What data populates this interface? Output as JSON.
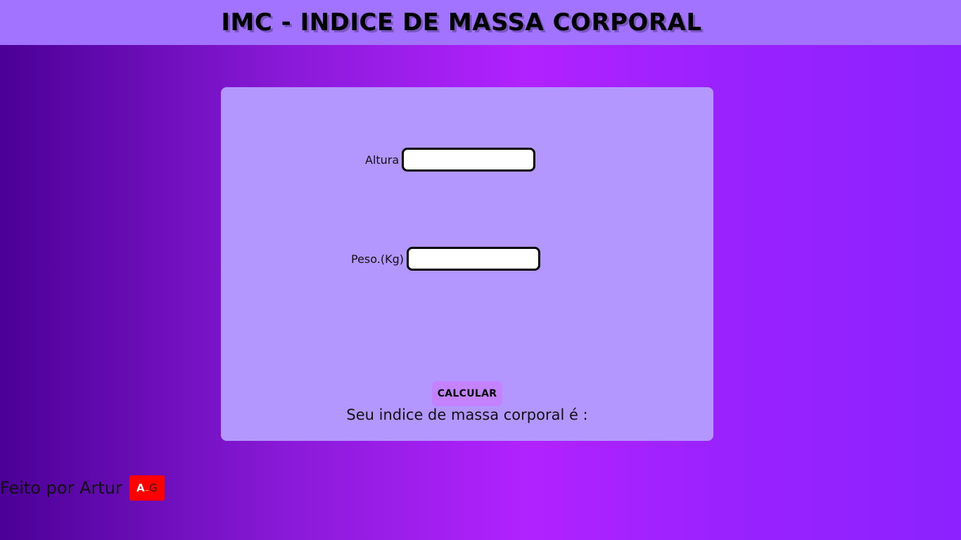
{
  "header": {
    "title": "IMC - INDICE DE MASSA CORPORAL"
  },
  "form": {
    "height_label": "Altura",
    "height_value": "",
    "weight_label": "Peso.(Kg)",
    "weight_value": "",
    "calculate_label": "CALCULAR",
    "result_text": "Seu indice de massa corporal é :"
  },
  "footer": {
    "credit": "Feito por Artur",
    "logo_text": "A_G"
  },
  "colors": {
    "header_bg": "#a273ff",
    "card_bg": "#b496ff",
    "button_bg": "#c482ff",
    "logo_bg": "#ff0000"
  }
}
